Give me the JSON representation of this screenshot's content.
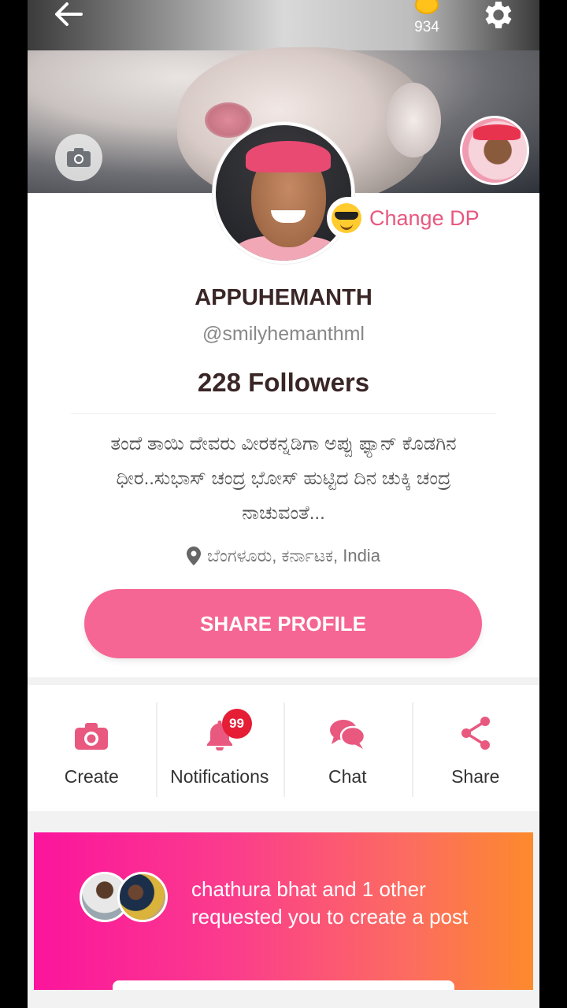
{
  "header": {
    "back_icon": "arrow-left-icon",
    "coins": "934",
    "settings_icon": "gear-icon"
  },
  "profile": {
    "change_dp_label": "Change DP",
    "name": "APPUHEMANTH",
    "handle": "@smilyhemanthml",
    "followers": "228 Followers",
    "bio": "ತಂದೆ ತಾಯಿ ದೇವರು  ವೀರಕನ್ನಡಿಗಾ ಅಪ್ಪು ಫ್ಯಾನ್  ಕೊಡಗಿನ ಧೀರ..ಸುಭಾಸ್ ಚಂದ್ರ ಭೋಸ್ ಹುಟ್ಟಿದ ದಿನ  ಚುಕ್ಕಿ ಚಂದ್ರ ನಾಚುವಂತೆ...",
    "location": "ಬೆಂಗಳೂರು, ಕರ್ನಾಟಕ, India",
    "share_button": "SHARE PROFILE"
  },
  "actions": [
    {
      "label": "Create",
      "icon": "camera-icon"
    },
    {
      "label": "Notifications",
      "icon": "bell-icon",
      "badge": "99"
    },
    {
      "label": "Chat",
      "icon": "chat-bubbles-icon"
    },
    {
      "label": "Share",
      "icon": "share-icon"
    }
  ],
  "request_banner": {
    "text": "chathura bhat and 1 other requested you to create a post"
  },
  "colors": {
    "accent": "#f56694",
    "icon_pink": "#e8587f",
    "badge_red": "#e51d35",
    "banner_start": "#fb149d",
    "banner_end": "#fd8a2d"
  }
}
